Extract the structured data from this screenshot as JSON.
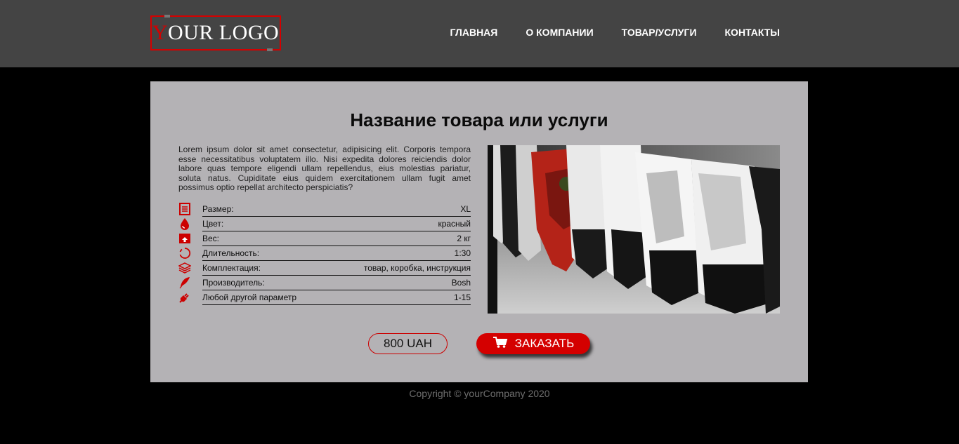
{
  "header": {
    "logo": {
      "first_letter": "Y",
      "rest": "OUR LOGO"
    },
    "nav": [
      {
        "label": "ГЛАВНАЯ"
      },
      {
        "label": "О КОМПАНИИ"
      },
      {
        "label": "ТОВАР/УСЛУГИ"
      },
      {
        "label": "КОНТАКТЫ"
      }
    ]
  },
  "product": {
    "title": "Название товара или услуги",
    "description": "Lorem ipsum dolor sit amet consectetur, adipisicing elit. Corporis tempora esse necessitatibus voluptatem illo. Nisi expedita dolores reiciendis dolor labore quas tempore eligendi ullam repellendus, eius molestias pariatur, soluta natus. Cupiditate eius quidem exercitationem ullam fugit amet possimus optio repellat architecto perspiciatis?",
    "specs": [
      {
        "icon": "document-icon",
        "label": "Размер:",
        "value": "XL"
      },
      {
        "icon": "drop-icon",
        "label": "Цвет:",
        "value": "красный"
      },
      {
        "icon": "scale-icon",
        "label": "Вес:",
        "value": "2 кг"
      },
      {
        "icon": "timer-icon",
        "label": "Длительность:",
        "value": "1:30"
      },
      {
        "icon": "layers-icon",
        "label": "Комплектация:",
        "value": "товар, коробка, инструкция"
      },
      {
        "icon": "feather-icon",
        "label": "Производитель:",
        "value": "Bosh"
      },
      {
        "icon": "plug-icon",
        "label": "Любой другой параметр",
        "value": "1-15"
      }
    ],
    "price": "800 UAH",
    "order_label": "ЗАКАЗАТЬ"
  },
  "colors": {
    "accent": "#d40000",
    "header_bg": "#444444",
    "card_bg": "#b4b2b5",
    "page_bg": "#000000"
  },
  "footer": {
    "copyright": "Copyright © yourCompany 2020"
  }
}
